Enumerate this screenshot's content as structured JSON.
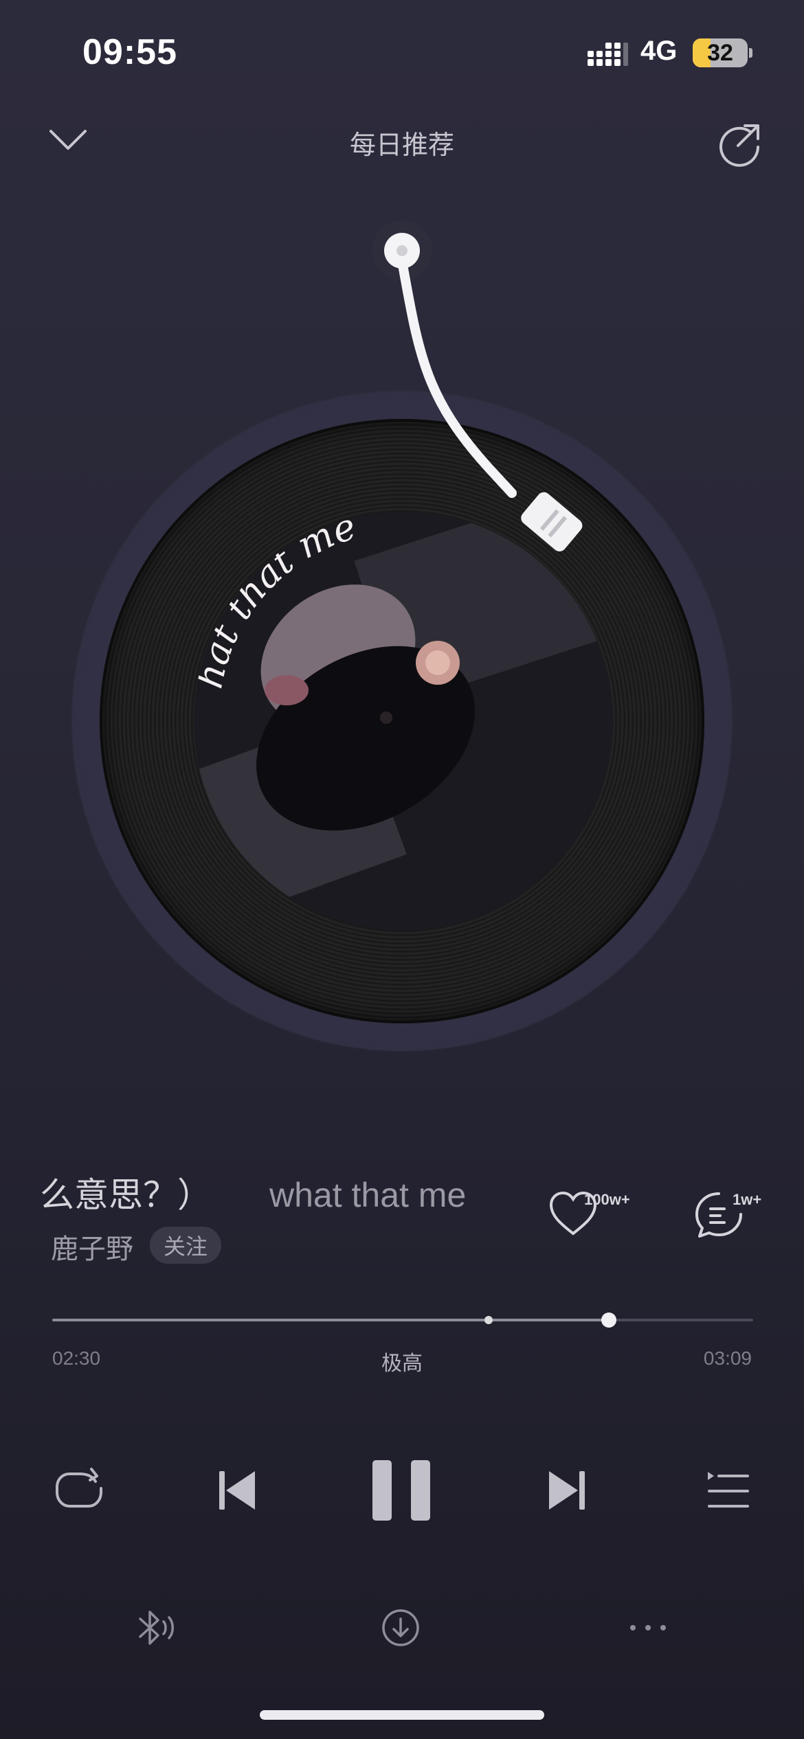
{
  "status_bar": {
    "time": "09:55",
    "network": "4G",
    "battery": "32",
    "battery_level": 0.32
  },
  "header": {
    "title": "每日推荐",
    "collapse_icon": "chevron-down-icon",
    "share_icon": "share-icon"
  },
  "cover_art": {
    "overlay_text": "hat that mea"
  },
  "song": {
    "title_visible": "么意思？）",
    "title_scroll": "what that me",
    "artist": "鹿子野",
    "follow_label": "关注",
    "like_count": "100w+",
    "comment_count": "1w+"
  },
  "playback": {
    "current_time": "02:30",
    "total_time": "03:09",
    "quality": "极高",
    "progress": 0.794,
    "buffered": 0.623
  },
  "controls": {
    "repeat_icon": "repeat-icon",
    "prev_icon": "previous-icon",
    "pause_icon": "pause-icon",
    "next_icon": "next-icon",
    "playlist_icon": "playlist-icon"
  },
  "bottom_bar": {
    "bluetooth_icon": "bluetooth-audio-icon",
    "download_icon": "download-icon",
    "more_icon": "more-icon"
  },
  "colors": {
    "background": "#2a2938",
    "accent_battery": "#f6c945"
  }
}
